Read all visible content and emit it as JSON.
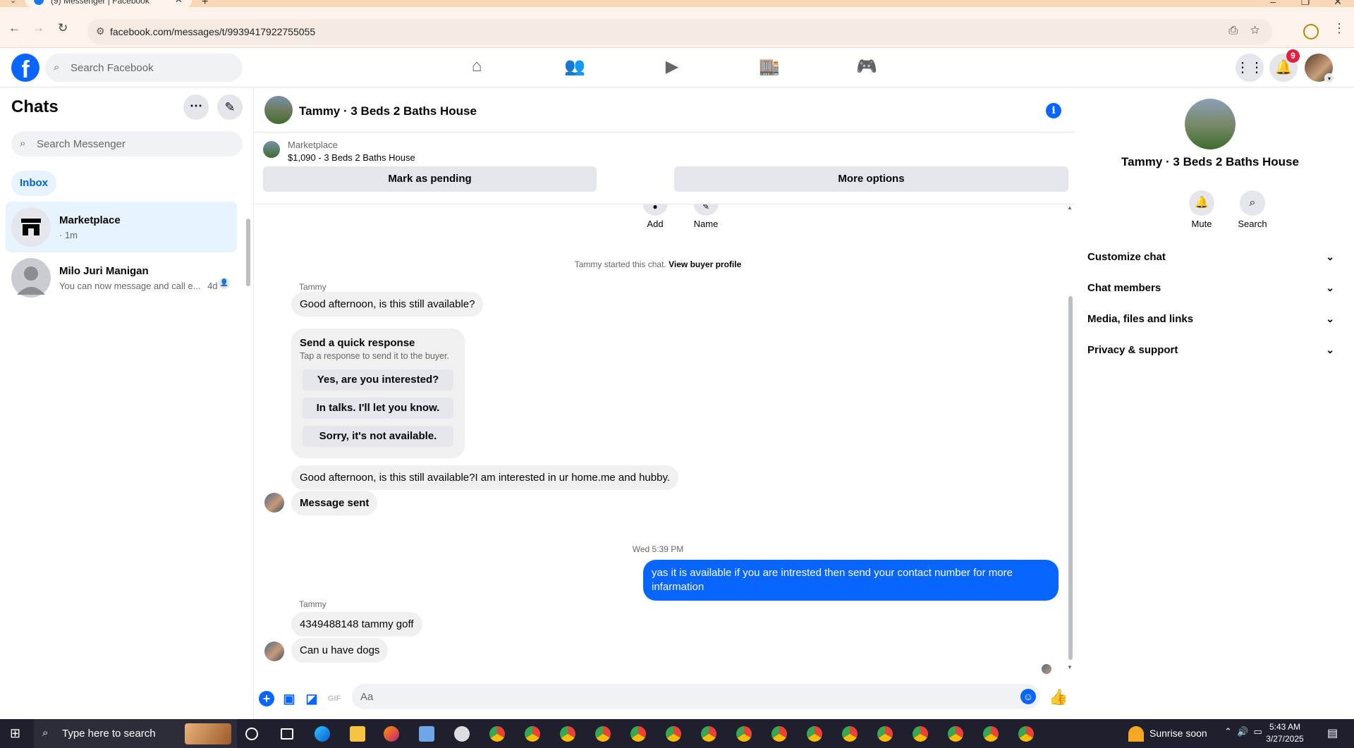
{
  "browser": {
    "tab_title": "(9) Messenger | Facebook",
    "url": "facebook.com/messages/t/9939417922755055"
  },
  "fb": {
    "search_placeholder": "Search Facebook",
    "notification_count": "9",
    "nav_icons": [
      "home-icon",
      "friends-icon",
      "video-icon",
      "marketplace-icon",
      "gaming-icon"
    ]
  },
  "sidebar": {
    "title": "Chats",
    "search_placeholder": "Search Messenger",
    "filter": "Inbox",
    "chats": [
      {
        "name": "Marketplace",
        "subtitle": "· 1m"
      },
      {
        "name": "Milo Juri Manigan",
        "subtitle": "You can now message and call e...",
        "time": "4d"
      }
    ]
  },
  "conversation": {
    "title": "Tammy · 3 Beds 2 Baths House",
    "marketplace_label": "Marketplace",
    "listing": "$1,090 - 3 Beds 2 Baths House",
    "mark_pending": "Mark as pending",
    "more_options": "More options",
    "top_actions": [
      "Add",
      "Name"
    ],
    "system_text": "Tammy started this chat.",
    "system_link": "View buyer profile",
    "sender_name": "Tammy",
    "msg1": "Good afternoon, is this still available?",
    "quick_response": {
      "heading": "Send a quick response",
      "hint": "Tap a response to send it to the buyer.",
      "options": [
        "Yes, are you interested?",
        "In talks. I'll let you know.",
        "Sorry, it's not available."
      ]
    },
    "msg2": "Good afternoon, is this still available?I am interested  in ur home.me and hubby.",
    "msg3": "Message sent",
    "timestamp": "Wed 5:39 PM",
    "outgoing": "yas it is available if you are intrested then send your contact number for more infarmation",
    "msg4": "4349488148 tammy goff",
    "msg5": "Can u have dogs",
    "composer_placeholder": "Aa"
  },
  "right_panel": {
    "title": "Tammy · 3 Beds 2 Baths House",
    "actions": [
      "Mute",
      "Search"
    ],
    "sections": [
      "Customize chat",
      "Chat members",
      "Media, files and links",
      "Privacy & support"
    ]
  },
  "taskbar": {
    "search_placeholder": "Type here to search",
    "weather": "Sunrise soon",
    "time": "5:43 AM",
    "date": "3/27/2025"
  },
  "colors": {
    "accent": "#0866ff",
    "badge": "#e41e3f",
    "selected_bg": "#e7f3ff"
  }
}
